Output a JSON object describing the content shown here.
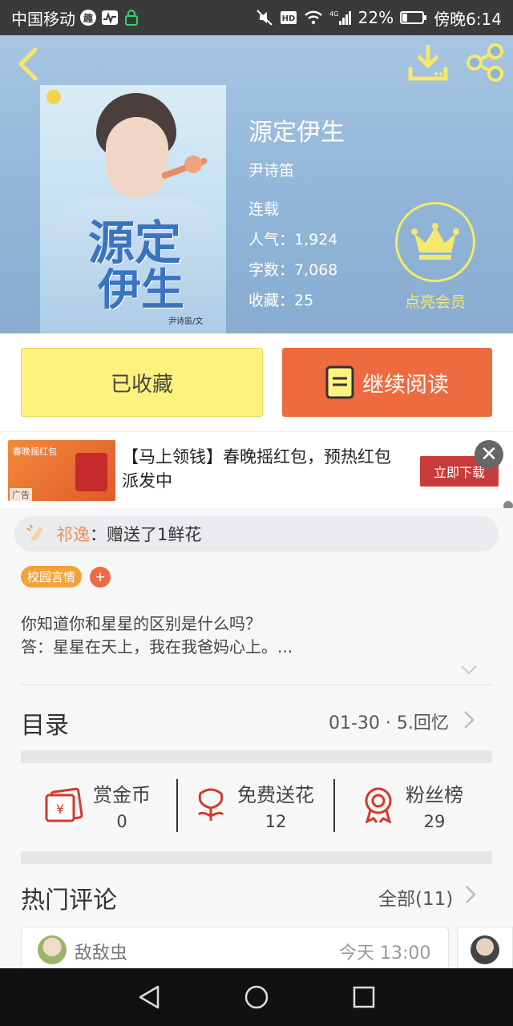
{
  "status_bar": {
    "carrier": "中国移动",
    "battery": "22%",
    "time": "傍晚6:14",
    "network": "4G"
  },
  "book": {
    "title": "源定伊生",
    "author": "尹诗笛",
    "status": "连载",
    "popularity_label": "人气：1,924",
    "words_label": "字数：7,068",
    "favorites_label": "收藏：25",
    "vip_label": "点亮会员",
    "cover_title_line1": "源定",
    "cover_title_line2": "伊生",
    "cover_author": "尹诗笛/文"
  },
  "actions": {
    "favorited_label": "已收藏",
    "continue_label": "继续阅读"
  },
  "ad": {
    "title": "【马上领钱】春晚摇红包，预热红包派发中",
    "button": "立即下载",
    "thumb_text": "春晚摇红包",
    "ad_tag": "广告"
  },
  "gift": {
    "user": "祁逸",
    "message": "：赠送了1鲜花"
  },
  "tags": [
    "校园言情"
  ],
  "synopsis": {
    "line1": "你知道你和星星的区别是什么吗？",
    "line2": "答：星星在天上，我在我爸妈心上。..."
  },
  "toc": {
    "title": "目录",
    "latest": "01-30 · 5.回忆"
  },
  "stats": [
    {
      "label": "赏金币",
      "value": "0"
    },
    {
      "label": "免费送花",
      "value": "12"
    },
    {
      "label": "粉丝榜",
      "value": "29"
    }
  ],
  "comments": {
    "title": "热门评论",
    "all_label": "全部(11)",
    "first": {
      "user": "敌敌虫",
      "time": "今天 13:00"
    }
  },
  "colors": {
    "accent_orange": "#ee6a3f",
    "favorite_yellow": "#fdf27d",
    "vip_yellow": "#f6e86a",
    "icon_red": "#d23a2a"
  }
}
